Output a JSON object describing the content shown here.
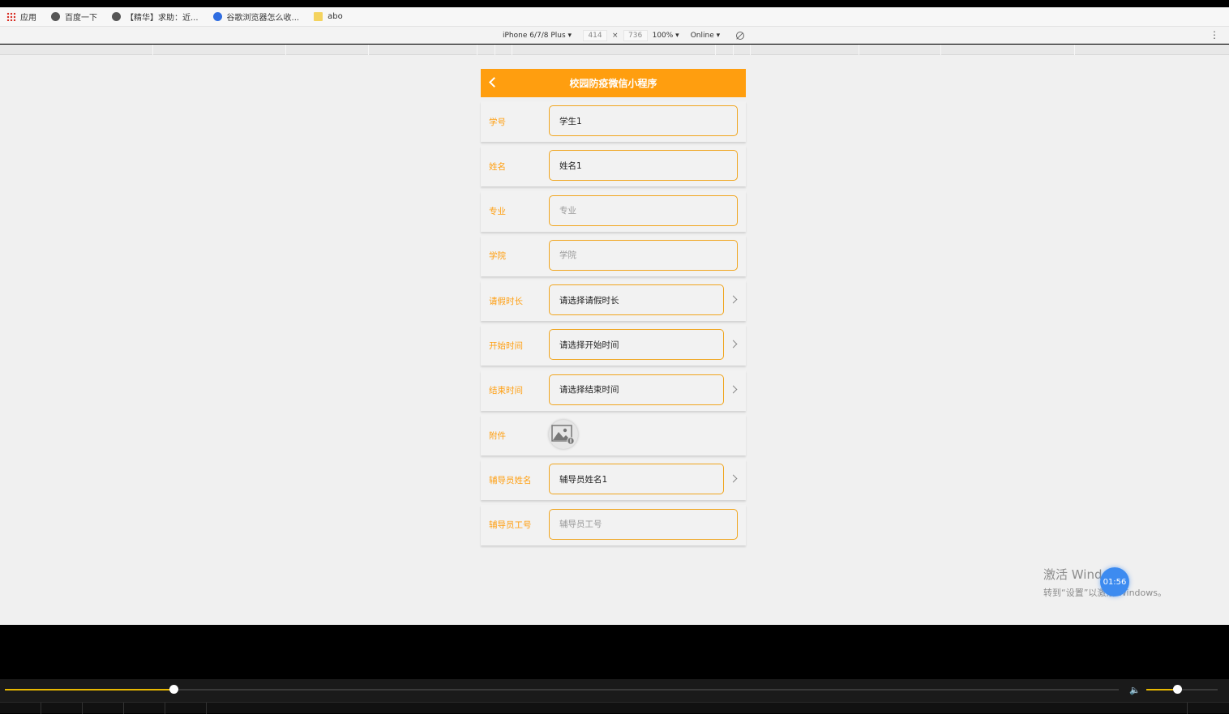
{
  "bookmarks": [
    {
      "icon": "apps-icon",
      "label": "应用"
    },
    {
      "icon": "globe-icon",
      "label": "百度一下"
    },
    {
      "icon": "globe-icon",
      "label": "【精华】求助：近..."
    },
    {
      "icon": "paw-icon",
      "label": "谷歌浏览器怎么收..."
    },
    {
      "icon": "folder-icon",
      "label": "abo"
    }
  ],
  "devtools": {
    "device": "iPhone 6/7/8 Plus ▾",
    "width": "414",
    "x": "×",
    "height": "736",
    "zoom": "100% ▾",
    "network": "Online ▾",
    "more": "⋮"
  },
  "app": {
    "title": "校园防疫微信小程序",
    "fields": {
      "student_id": {
        "label": "学号",
        "value": "学生1"
      },
      "name": {
        "label": "姓名",
        "value": "姓名1"
      },
      "major": {
        "label": "专业",
        "placeholder": "专业"
      },
      "college": {
        "label": "学院",
        "placeholder": "学院"
      },
      "duration": {
        "label": "请假时长",
        "value": "请选择请假时长"
      },
      "start": {
        "label": "开始时间",
        "value": "请选择开始时间"
      },
      "end": {
        "label": "结束时间",
        "value": "请选择结束时间"
      },
      "attachment": {
        "label": "附件"
      },
      "counselor_name": {
        "label": "辅导员姓名",
        "value": "辅导员姓名1"
      },
      "counselor_id": {
        "label": "辅导员工号",
        "placeholder": "辅导员工号"
      }
    }
  },
  "watermark": {
    "line1": "激活 Windows",
    "line2": "转到“设置”以激活 Windows。"
  },
  "timer": "01:56",
  "player": {
    "progress": 0.152,
    "volume": 0.44
  }
}
